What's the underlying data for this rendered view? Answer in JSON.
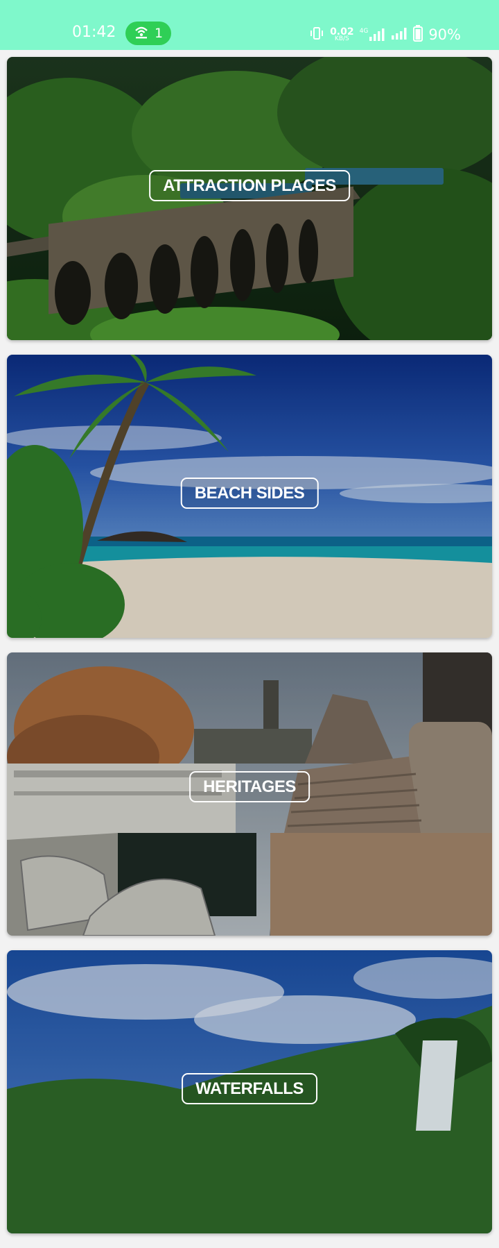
{
  "status_bar": {
    "time": "01:42",
    "hotspot_count": "1",
    "net_speed_value": "0.02",
    "net_speed_unit": "KB/S",
    "network_type": "4G",
    "battery": "90%"
  },
  "categories": [
    {
      "label": "ATTRACTION PLACES",
      "icon": "train-bridge-photo"
    },
    {
      "label": "BEACH SIDES",
      "icon": "beach-photo"
    },
    {
      "label": "HERITAGES",
      "icon": "heritage-photo"
    },
    {
      "label": "WATERFALLS",
      "icon": "waterfall-photo"
    }
  ]
}
